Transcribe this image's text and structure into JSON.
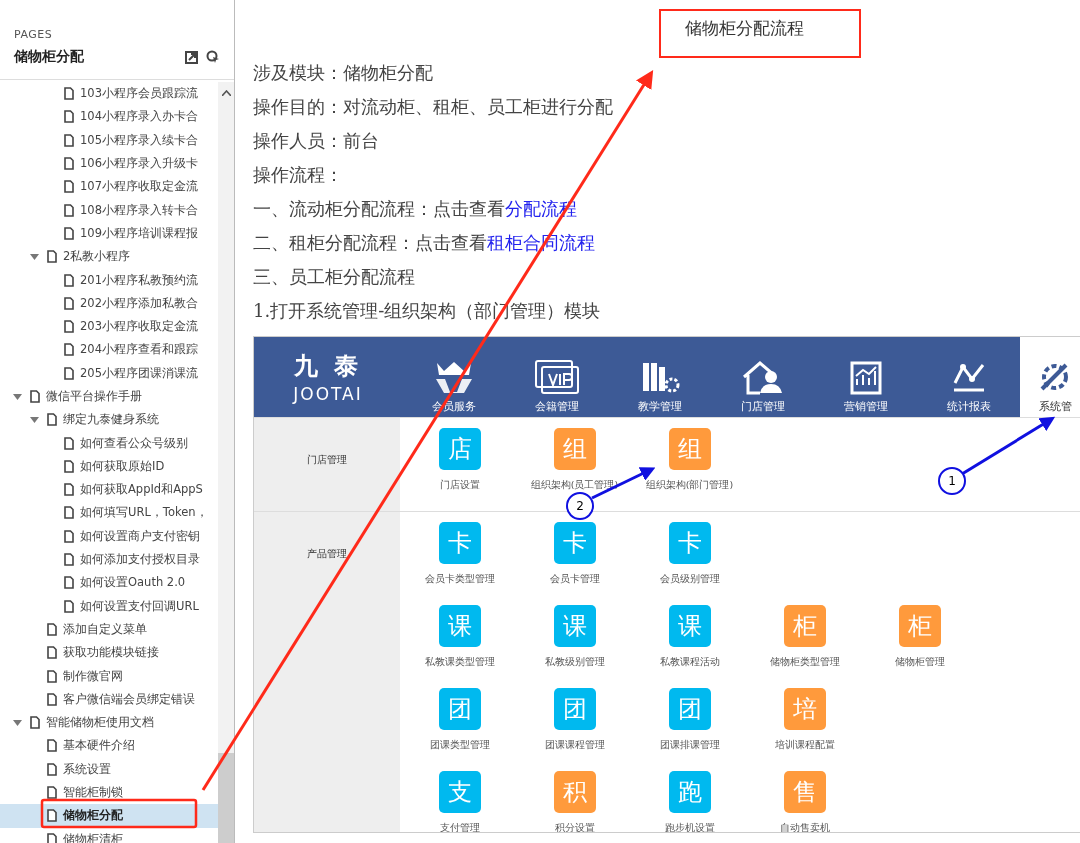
{
  "sidebar": {
    "heading": "PAGES",
    "title": "储物柜分配",
    "tree": [
      {
        "children": [
          {
            "children": [
              {
                "label": "103小程序会员跟踪流",
                "selected": false
              },
              {
                "label": "104小程序录入办卡合",
                "selected": false
              },
              {
                "label": "105小程序录入续卡合",
                "selected": false
              },
              {
                "label": "106小程序录入升级卡",
                "selected": false
              },
              {
                "label": "107小程序收取定金流",
                "selected": false
              },
              {
                "label": "108小程序录入转卡合",
                "selected": false
              },
              {
                "label": "109小程序培训课程报",
                "selected": false
              }
            ]
          },
          {
            "label": "2私教小程序",
            "selected": false,
            "expanded": true,
            "children": [
              {
                "label": "201小程序私教预约流",
                "selected": false
              },
              {
                "label": "202小程序添加私教合",
                "selected": false
              },
              {
                "label": "203小程序收取定金流",
                "selected": false
              },
              {
                "label": "204小程序查看和跟踪",
                "selected": false
              },
              {
                "label": "205小程序团课消课流",
                "selected": false
              }
            ]
          }
        ]
      },
      {
        "label": "微信平台操作手册",
        "selected": false,
        "expanded": true,
        "children": [
          {
            "label": "绑定九泰健身系统",
            "selected": false,
            "expanded": true,
            "children": [
              {
                "label": "如何查看公众号级别",
                "selected": false
              },
              {
                "label": "如何获取原始ID",
                "selected": false
              },
              {
                "label": "如何获取AppId和AppS",
                "selected": false
              },
              {
                "label": "如何填写URL，Token，",
                "selected": false
              },
              {
                "label": "如何设置商户支付密钥",
                "selected": false
              },
              {
                "label": "如何添加支付授权目录",
                "selected": false
              },
              {
                "label": "如何设置Oauth 2.0",
                "selected": false
              },
              {
                "label": "如何设置支付回调URL",
                "selected": false
              }
            ]
          },
          {
            "label": "添加自定义菜单",
            "selected": false
          },
          {
            "label": "获取功能模块链接",
            "selected": false
          },
          {
            "label": "制作微官网",
            "selected": false
          },
          {
            "label": "客户微信端会员绑定错误",
            "selected": false
          }
        ]
      },
      {
        "label": "智能储物柜使用文档",
        "selected": false,
        "expanded": true,
        "children": [
          {
            "label": "基本硬件介绍",
            "selected": false
          },
          {
            "label": "系统设置",
            "selected": false
          },
          {
            "label": "智能柜制锁",
            "selected": false
          },
          {
            "label": "储物柜分配",
            "selected": true
          },
          {
            "label": "储物柜清柜",
            "selected": false
          }
        ]
      }
    ]
  },
  "document": {
    "title": "储物柜分配流程",
    "lines": [
      {
        "text": "涉及模块：储物柜分配"
      },
      {
        "text": "操作目的：对流动柜、租柜、员工柜进行分配"
      },
      {
        "text": "操作人员：前台"
      },
      {
        "text": "操作流程："
      },
      {
        "text": "一、流动柜分配流程：点击查看",
        "link": "分配流程"
      },
      {
        "text": "二、租柜分配流程：点击查看",
        "link": "租柜合同流程"
      },
      {
        "text": "三、员工柜分配流程"
      },
      {
        "text": "1.打开系统管理-组织架构（部门管理）模块"
      }
    ],
    "app_screenshot": {
      "logo": {
        "name": "九 泰",
        "subtitle": "JOOTAI"
      },
      "nav": [
        {
          "label": "会员服务",
          "selected": false
        },
        {
          "label": "会籍管理",
          "selected": false
        },
        {
          "label": "教学管理",
          "selected": false
        },
        {
          "label": "门店管理",
          "selected": false
        },
        {
          "label": "营销管理",
          "selected": false
        },
        {
          "label": "统计报表",
          "selected": false
        },
        {
          "label": "系统管",
          "selected": true
        }
      ],
      "sections": [
        {
          "label": "门店管理",
          "rows": [
            [
              {
                "char": "店",
                "label": "门店设置",
                "color": "#00b9ef"
              },
              {
                "char": "组",
                "label": "组织架构(员工管理)",
                "color": "#ff9a3c"
              },
              {
                "char": "组",
                "label": "组织架构(部门管理)",
                "color": "#ff9a3c"
              }
            ]
          ]
        },
        {
          "label": "产品管理",
          "rows": [
            [
              {
                "char": "卡",
                "label": "会员卡类型管理",
                "color": "#00b9ef"
              },
              {
                "char": "卡",
                "label": "会员卡管理",
                "color": "#00b9ef"
              },
              {
                "char": "卡",
                "label": "会员级别管理",
                "color": "#00b9ef"
              }
            ],
            [
              {
                "char": "课",
                "label": "私教课类型管理",
                "color": "#00b9ef"
              },
              {
                "char": "课",
                "label": "私教级别管理",
                "color": "#00b9ef"
              },
              {
                "char": "课",
                "label": "私教课程活动",
                "color": "#00b9ef"
              },
              {
                "char": "柜",
                "label": "储物柜类型管理",
                "color": "#ff9a3c"
              },
              {
                "char": "柜",
                "label": "储物柜管理",
                "color": "#ff9a3c"
              }
            ],
            [
              {
                "char": "团",
                "label": "团课类型管理",
                "color": "#00b9ef"
              },
              {
                "char": "团",
                "label": "团课课程管理",
                "color": "#00b9ef"
              },
              {
                "char": "团",
                "label": "团课排课管理",
                "color": "#00b9ef"
              },
              {
                "char": "培",
                "label": "培训课程配置",
                "color": "#ff9a3c"
              }
            ],
            [
              {
                "char": "支",
                "label": "支付管理",
                "color": "#00b9ef"
              },
              {
                "char": "积",
                "label": "积分设置",
                "color": "#ff9a3c"
              },
              {
                "char": "跑",
                "label": "跑步机设置",
                "color": "#00b9ef"
              },
              {
                "char": "售",
                "label": "自动售卖机",
                "color": "#ff9a3c"
              }
            ]
          ]
        }
      ]
    }
  },
  "annotations": [
    {
      "label": "1"
    },
    {
      "label": "2"
    }
  ]
}
